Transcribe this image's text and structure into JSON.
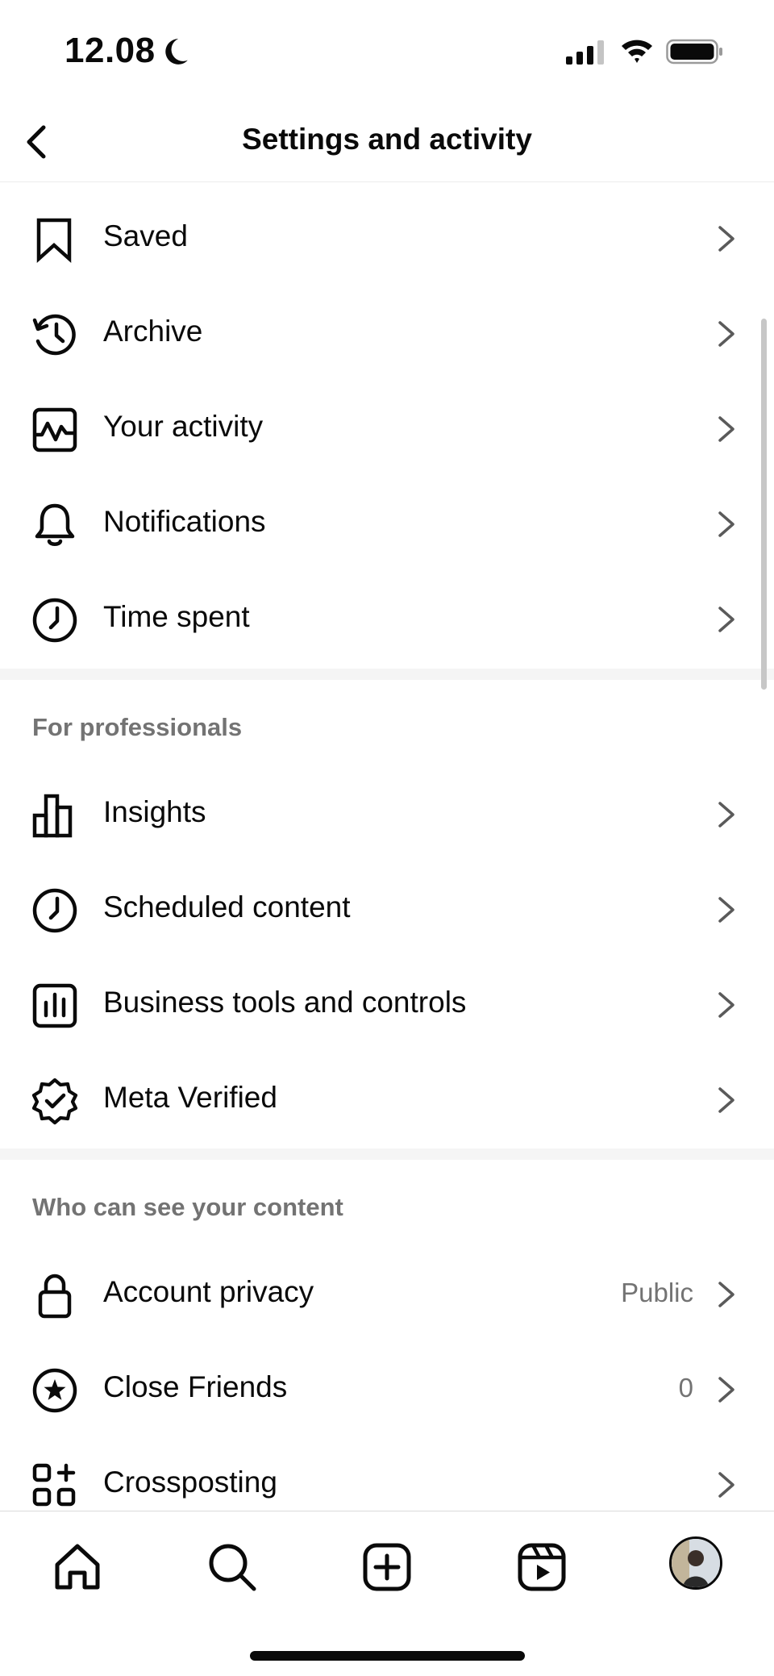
{
  "status_bar": {
    "time": "12.08"
  },
  "header": {
    "title": "Settings and activity"
  },
  "section_activity": {
    "items": [
      {
        "label": "Saved",
        "icon": "bookmark-icon"
      },
      {
        "label": "Archive",
        "icon": "archive-history-icon"
      },
      {
        "label": "Your activity",
        "icon": "activity-chart-icon"
      },
      {
        "label": "Notifications",
        "icon": "bell-icon"
      },
      {
        "label": "Time spent",
        "icon": "clock-icon"
      }
    ]
  },
  "section_professionals": {
    "title": "For professionals",
    "items": [
      {
        "label": "Insights",
        "icon": "bar-chart-icon"
      },
      {
        "label": "Scheduled content",
        "icon": "clock-icon"
      },
      {
        "label": "Business tools and controls",
        "icon": "business-chart-icon"
      },
      {
        "label": "Meta Verified",
        "icon": "verified-badge-icon"
      }
    ]
  },
  "section_visibility": {
    "title": "Who can see your content",
    "items": [
      {
        "label": "Account privacy",
        "value": "Public",
        "icon": "lock-icon"
      },
      {
        "label": "Close Friends",
        "value": "0",
        "icon": "star-circle-icon"
      },
      {
        "label": "Crossposting",
        "icon": "apps-plus-icon"
      }
    ]
  },
  "bottom_nav": {
    "items": [
      {
        "icon": "home-icon"
      },
      {
        "icon": "search-icon"
      },
      {
        "icon": "create-icon"
      },
      {
        "icon": "reels-icon"
      },
      {
        "icon": "profile-avatar"
      }
    ]
  }
}
